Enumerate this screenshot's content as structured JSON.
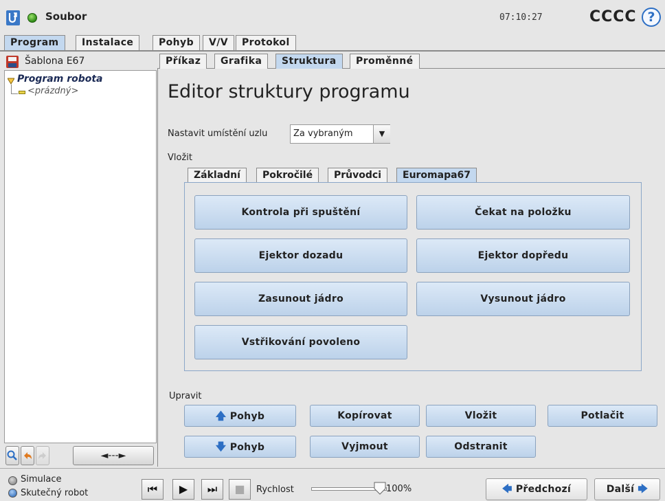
{
  "titlebar": {
    "file_label": "Soubor",
    "clock": "07:10:27",
    "robot_name": "CCCC",
    "help": "?"
  },
  "main_tabs": [
    {
      "label": "Program",
      "active": true
    },
    {
      "label": "Instalace",
      "active": false
    },
    {
      "label": "Pohyb",
      "active": false
    },
    {
      "label": "V/V",
      "active": false
    },
    {
      "label": "Protokol",
      "active": false
    }
  ],
  "left": {
    "template_name": "Šablona E67",
    "tree_root": "Program robota",
    "tree_child": "<prázdný>",
    "arrow_label": "◄---►"
  },
  "content_tabs": [
    {
      "label": "Příkaz",
      "active": false
    },
    {
      "label": "Grafika",
      "active": false
    },
    {
      "label": "Struktura",
      "active": true
    },
    {
      "label": "Proměnné",
      "active": false
    }
  ],
  "editor": {
    "title": "Editor struktury programu",
    "node_label": "Nastavit umístění uzlu",
    "node_value": "Za vybraným",
    "insert_label": "Vložit",
    "edit_label": "Upravit"
  },
  "insert_tabs": [
    {
      "label": "Základní",
      "active": false
    },
    {
      "label": "Pokročilé",
      "active": false
    },
    {
      "label": "Průvodci",
      "active": false
    },
    {
      "label": "Euromapa67",
      "active": true
    }
  ],
  "insert_buttons": {
    "b1": "Kontrola při spuštění",
    "b2": "Čekat na položku",
    "b3": "Ejektor dozadu",
    "b4": "Ejektor dopředu",
    "b5": "Zasunout jádro",
    "b6": "Vysunout jádro",
    "b7": "Vstřikování povoleno"
  },
  "edit_buttons": {
    "move_up": "Pohyb",
    "move_down": "Pohyb",
    "copy": "Kopírovat",
    "cut": "Vyjmout",
    "paste": "Vložit",
    "delete": "Odstranit",
    "suppress": "Potlačit"
  },
  "bottom": {
    "simulation": "Simulace",
    "real_robot": "Skutečný robot",
    "speed_label": "Rychlost",
    "speed_value": "100%",
    "speed_fraction": 1.0,
    "prev": "Předchozí",
    "next": "Další"
  },
  "colors": {
    "active_tab": "#c3d8ef",
    "button_blue": "#c9dcef",
    "arrow_blue": "#2d6fc4",
    "ur_logo_blue": "#3a78c7"
  }
}
